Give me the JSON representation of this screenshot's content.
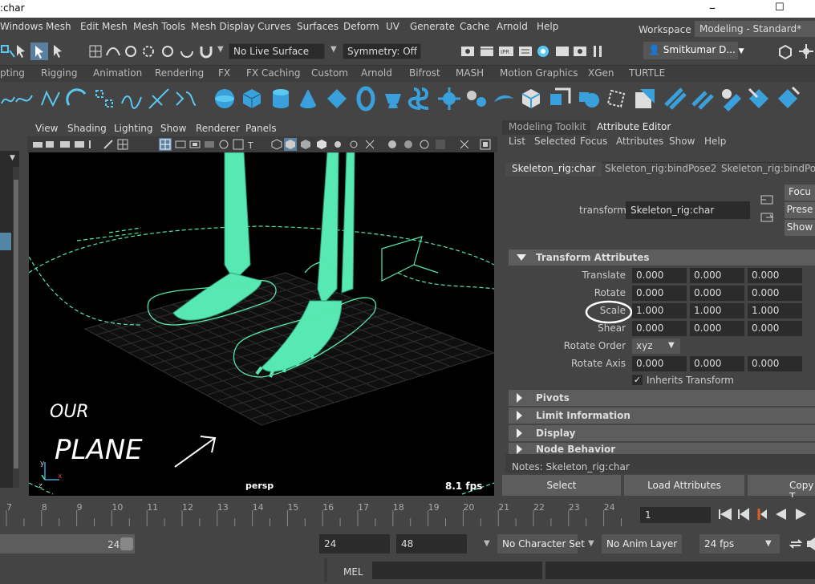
{
  "title_bar": {
    "title": ":char",
    "minimize": "–",
    "maximize": "☐"
  },
  "menu": [
    "Windows",
    "Mesh",
    "Edit Mesh",
    "Mesh Tools",
    "Mesh Display",
    "Curves",
    "Surfaces",
    "Deform",
    "UV",
    "Generate",
    "Cache",
    "Arnold",
    "Help"
  ],
  "workspace": {
    "label": "Workspace :",
    "value": "Modeling - Standard*"
  },
  "status": {
    "live_surface": "No Live Surface",
    "symmetry": "Symmetry: Off",
    "user": "Smitkumar D..."
  },
  "shelf_tabs": [
    "pting",
    "Rigging",
    "Animation",
    "Rendering",
    "FX",
    "FX Caching",
    "Custom",
    "Arnold",
    "Bifrost",
    "MASH",
    "Motion Graphics",
    "XGen",
    "TURTLE"
  ],
  "viewport": {
    "menu": [
      "View",
      "Shading",
      "Lighting",
      "Show",
      "Renderer",
      "Panels"
    ],
    "camera": "persp",
    "fps": "8.1 fps",
    "annotation_line1": "OUR",
    "annotation_line2": "PLANE"
  },
  "attribute_editor": {
    "tabs": [
      "Modeling Toolkit",
      "Attribute Editor"
    ],
    "menu": [
      "List",
      "Selected",
      "Focus",
      "Attributes",
      "Show",
      "Help"
    ],
    "node_tabs": [
      "Skeleton_rig:char",
      "Skeleton_rig:bindPose2",
      "Skeleton_rig:bindPose"
    ],
    "transform_label": "transform:",
    "transform_value": "Skeleton_rig:char",
    "side_buttons": [
      "Focu",
      "Prese",
      "Show"
    ],
    "sections": {
      "transform": "Transform Attributes",
      "pivots": "Pivots",
      "limit": "Limit Information",
      "display": "Display",
      "node": "Node Behavior"
    },
    "attrs": {
      "translate": {
        "label": "Translate",
        "x": "0.000",
        "y": "0.000",
        "z": "0.000"
      },
      "rotate": {
        "label": "Rotate",
        "x": "0.000",
        "y": "0.000",
        "z": "0.000"
      },
      "scale": {
        "label": "Scale",
        "x": "1.000",
        "y": "1.000",
        "z": "1.000"
      },
      "shear": {
        "label": "Shear",
        "x": "0.000",
        "y": "0.000",
        "z": "0.000"
      },
      "rotate_order": {
        "label": "Rotate Order",
        "value": "xyz"
      },
      "rotate_axis": {
        "label": "Rotate Axis",
        "x": "0.000",
        "y": "0.000",
        "z": "0.000"
      },
      "inherits": "Inherits Transform"
    },
    "notes": "Notes:  Skeleton_rig:char",
    "buttons": {
      "select": "Select",
      "load": "Load Attributes",
      "copy": "Copy T"
    }
  },
  "timeline": {
    "ticks": [
      "7",
      "8",
      "9",
      "10",
      "11",
      "12",
      "13",
      "14",
      "15",
      "16",
      "17",
      "18",
      "19",
      "20",
      "21",
      "22",
      "23",
      "24"
    ],
    "current_frame": "1"
  },
  "range": {
    "slider_end": "24",
    "end": "24",
    "anim_end": "48",
    "character_set": "No Character Set",
    "anim_layer": "No Anim Layer",
    "fps": "24 fps"
  },
  "cmd": {
    "label": "MEL"
  }
}
